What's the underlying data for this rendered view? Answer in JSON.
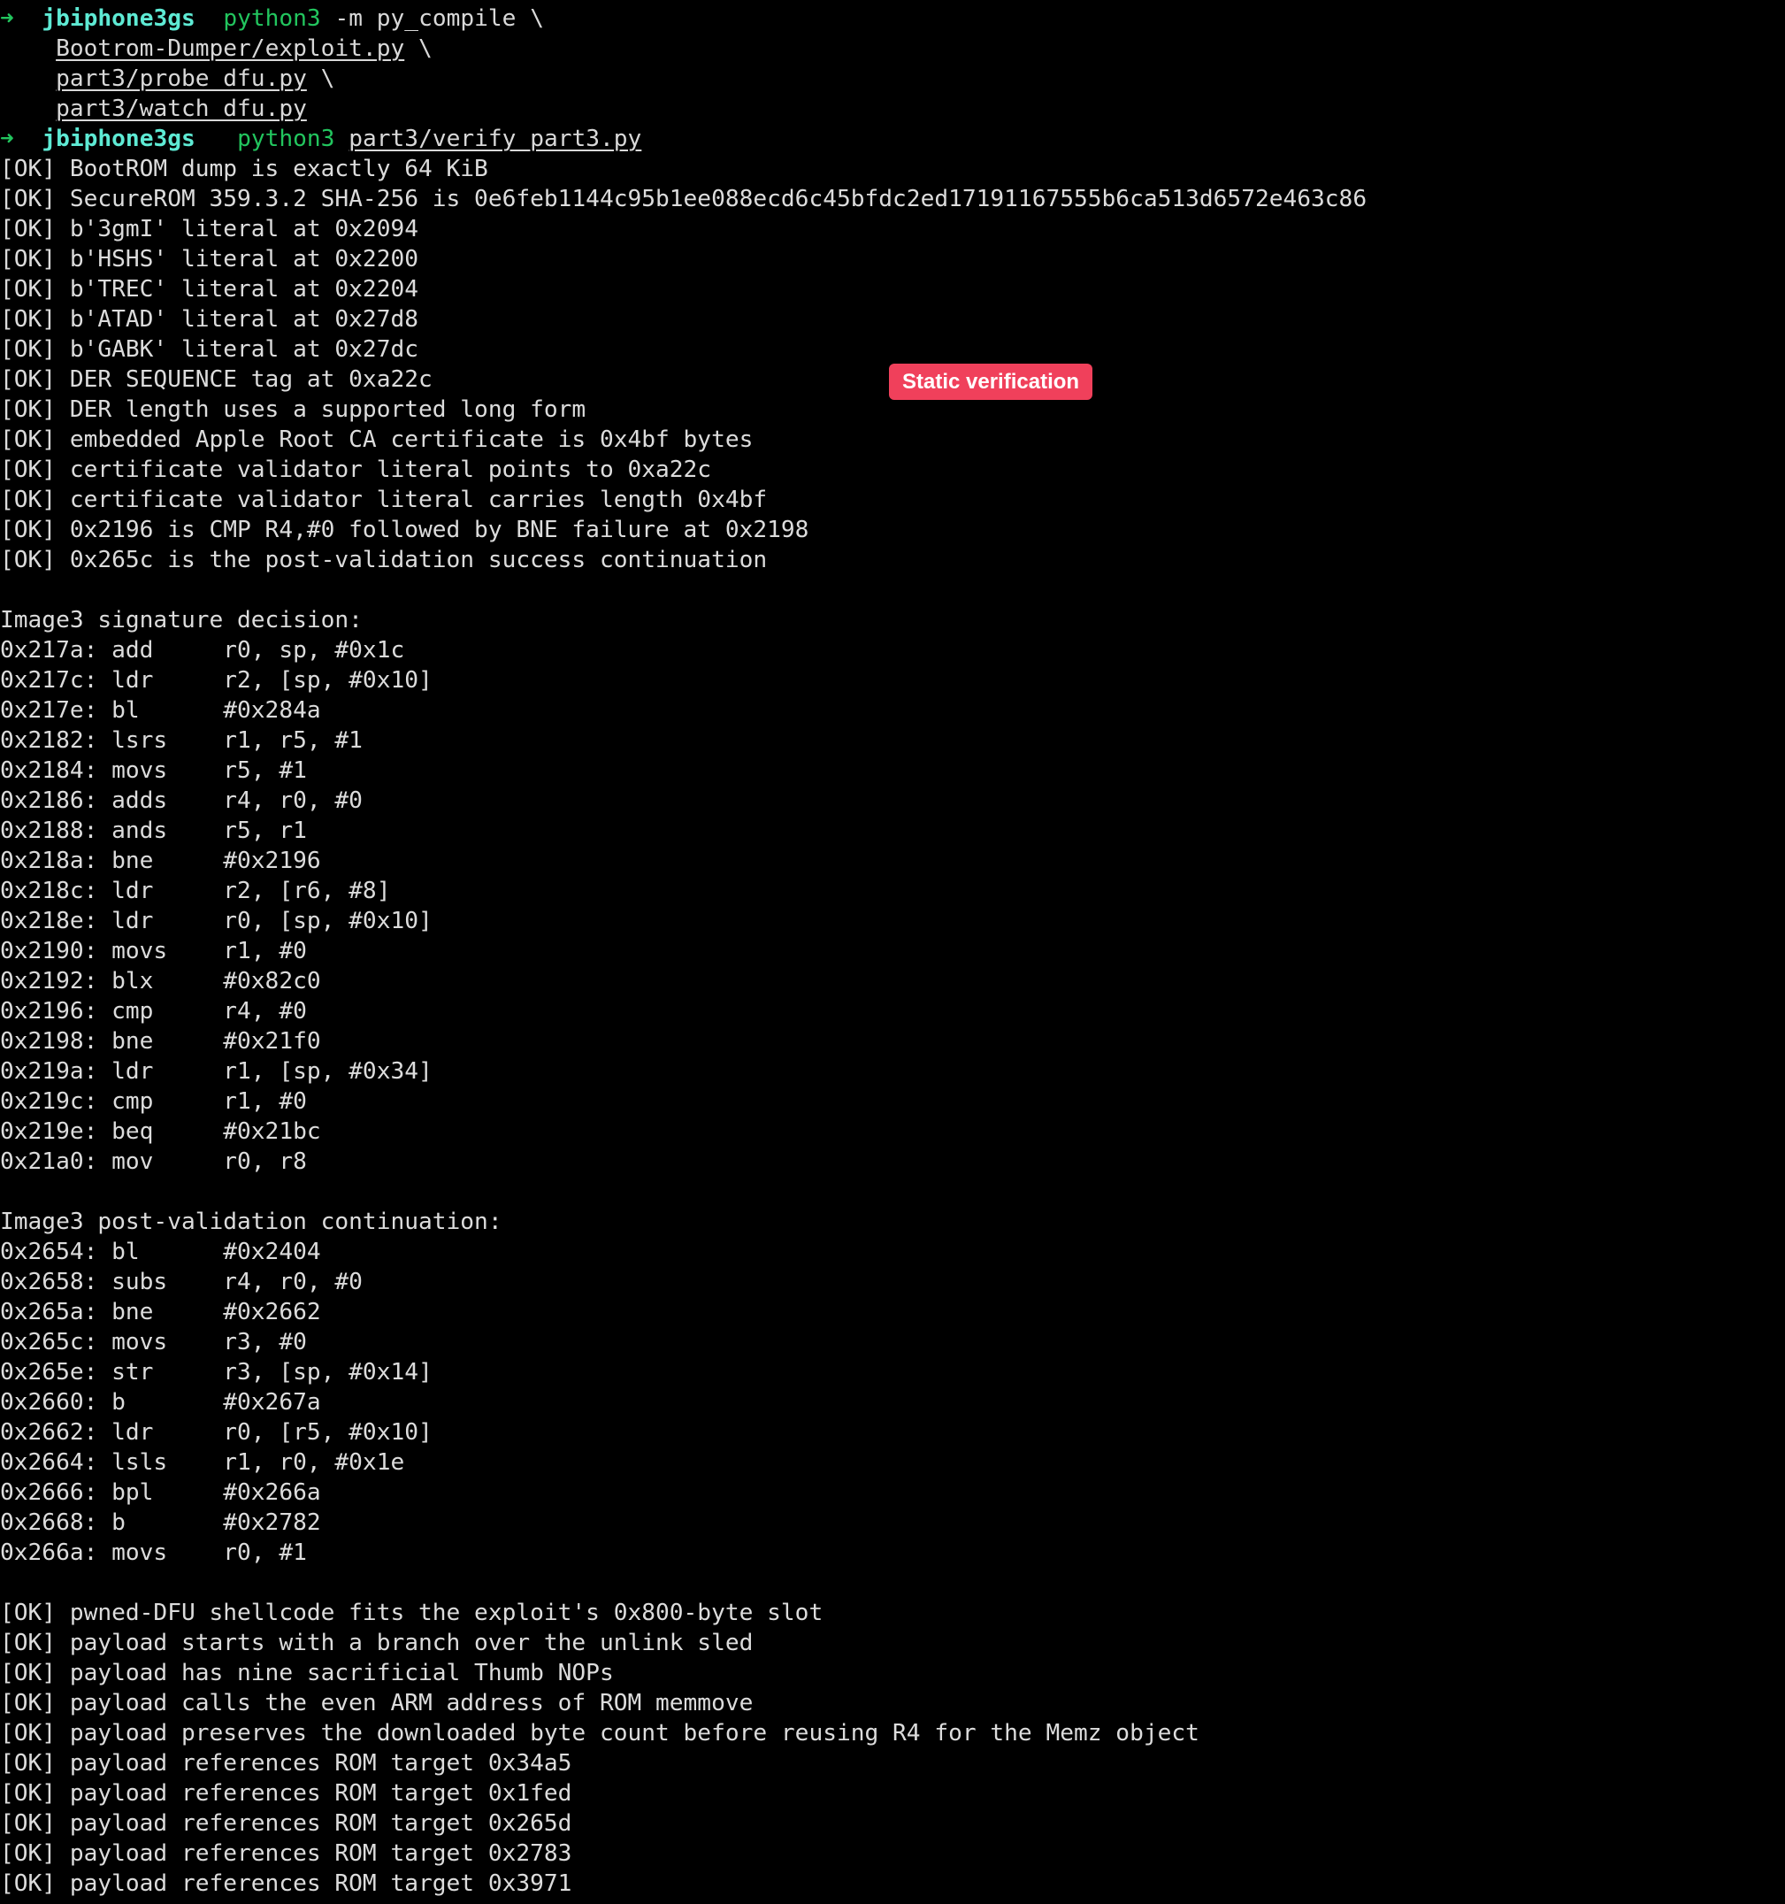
{
  "prompt": {
    "arrow": "➜",
    "host": "jbiphone3gs"
  },
  "cmd1": {
    "program": "python3",
    "args": "-m py_compile \\",
    "files": [
      "Bootrom-Dumper/exploit.py",
      "part3/probe_dfu.py",
      "part3/watch_dfu.py"
    ],
    "continuation": "\\"
  },
  "cmd2": {
    "program": "python3",
    "file": "part3/verify_part3.py"
  },
  "badge": {
    "label": "Static verification",
    "color": "#f0405b"
  },
  "static_checks": [
    "[OK] BootROM dump is exactly 64 KiB",
    "[OK] SecureROM 359.3.2 SHA-256 is 0e6feb1144c95b1ee088ecd6c45bfdc2ed17191167555b6ca513d6572e463c86",
    "[OK] b'3gmI' literal at 0x2094",
    "[OK] b'HSHS' literal at 0x2200",
    "[OK] b'TREC' literal at 0x2204",
    "[OK] b'ATAD' literal at 0x27d8",
    "[OK] b'GABK' literal at 0x27dc",
    "[OK] DER SEQUENCE tag at 0xa22c",
    "[OK] DER length uses a supported long form",
    "[OK] embedded Apple Root CA certificate is 0x4bf bytes",
    "[OK] certificate validator literal points to 0xa22c",
    "[OK] certificate validator literal carries length 0x4bf",
    "[OK] 0x2196 is CMP R4,#0 followed by BNE failure at 0x2198",
    "[OK] 0x265c is the post-validation success continuation"
  ],
  "signature_decision": {
    "heading": "Image3 signature decision:",
    "lines": [
      "0x217a: add     r0, sp, #0x1c",
      "0x217c: ldr     r2, [sp, #0x10]",
      "0x217e: bl      #0x284a",
      "0x2182: lsrs    r1, r5, #1",
      "0x2184: movs    r5, #1",
      "0x2186: adds    r4, r0, #0",
      "0x2188: ands    r5, r1",
      "0x218a: bne     #0x2196",
      "0x218c: ldr     r2, [r6, #8]",
      "0x218e: ldr     r0, [sp, #0x10]",
      "0x2190: movs    r1, #0",
      "0x2192: blx     #0x82c0",
      "0x2196: cmp     r4, #0",
      "0x2198: bne     #0x21f0",
      "0x219a: ldr     r1, [sp, #0x34]",
      "0x219c: cmp     r1, #0",
      "0x219e: beq     #0x21bc",
      "0x21a0: mov     r0, r8"
    ]
  },
  "post_validation": {
    "heading": "Image3 post-validation continuation:",
    "lines": [
      "0x2654: bl      #0x2404",
      "0x2658: subs    r4, r0, #0",
      "0x265a: bne     #0x2662",
      "0x265c: movs    r3, #0",
      "0x265e: str     r3, [sp, #0x14]",
      "0x2660: b       #0x267a",
      "0x2662: ldr     r0, [r5, #0x10]",
      "0x2664: lsls    r1, r0, #0x1e",
      "0x2666: bpl     #0x266a",
      "0x2668: b       #0x2782",
      "0x266a: movs    r0, #1"
    ]
  },
  "payload_checks": [
    "[OK] pwned-DFU shellcode fits the exploit's 0x800-byte slot",
    "[OK] payload starts with a branch over the unlink sled",
    "[OK] payload has nine sacrificial Thumb NOPs",
    "[OK] payload calls the even ARM address of ROM memmove",
    "[OK] payload preserves the downloaded byte count before reusing R4 for the Memz object",
    "[OK] payload references ROM target 0x34a5",
    "[OK] payload references ROM target 0x1fed",
    "[OK] payload references ROM target 0x265d",
    "[OK] payload references ROM target 0x2783",
    "[OK] payload references ROM target 0x3971"
  ]
}
